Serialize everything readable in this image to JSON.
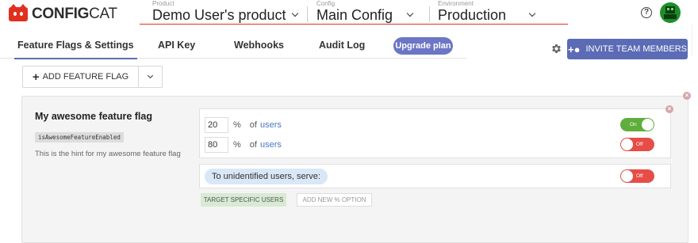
{
  "brand": {
    "logo_bold": "CONFIG",
    "logo_light": "CAT",
    "accent": "#e0301e"
  },
  "header": {
    "product": {
      "caption": "Product",
      "value": "Demo User's product"
    },
    "config": {
      "caption": "Config",
      "value": "Main Config"
    },
    "environment": {
      "caption": "Environment",
      "value": "Production"
    },
    "help_glyph": "?"
  },
  "tabs": [
    {
      "label": "Feature Flags & Settings",
      "active": true
    },
    {
      "label": "API Key",
      "active": false
    },
    {
      "label": "Webhooks",
      "active": false
    },
    {
      "label": "Audit Log",
      "active": false
    }
  ],
  "upgrade_label": "Upgrade plan",
  "invite_label": "INVITE TEAM MEMBERS",
  "add_flag": {
    "label": "ADD FEATURE FLAG",
    "plus": "+"
  },
  "flag": {
    "name": "My awesome feature flag",
    "key": "isAwesomeFeatureEnabled",
    "hint": "This is the hint for my awesome feature flag",
    "rules": [
      {
        "percent": "20",
        "pct_sign": "%",
        "of_text": "of",
        "link": "users",
        "toggle_label": "On",
        "on": true
      },
      {
        "percent": "80",
        "pct_sign": "%",
        "of_text": "of",
        "link": "users",
        "toggle_label": "Off",
        "on": false
      }
    ],
    "serve": {
      "text": "To unidentified users, serve:",
      "toggle_label": "Off",
      "on": false
    },
    "target_label": "TARGET SPECIFIC USERS",
    "add_option_label": "ADD NEW % OPTION"
  },
  "icons": {
    "gear": "gear-icon",
    "help": "help-circle-icon",
    "avatar": "avatar",
    "close": "close-icon",
    "add_user": "add-user-icon"
  },
  "colors": {
    "primary": "#5b6bb5",
    "upgrade": "#6c76c4",
    "on": "#5fae3b",
    "off": "#e74d47"
  }
}
